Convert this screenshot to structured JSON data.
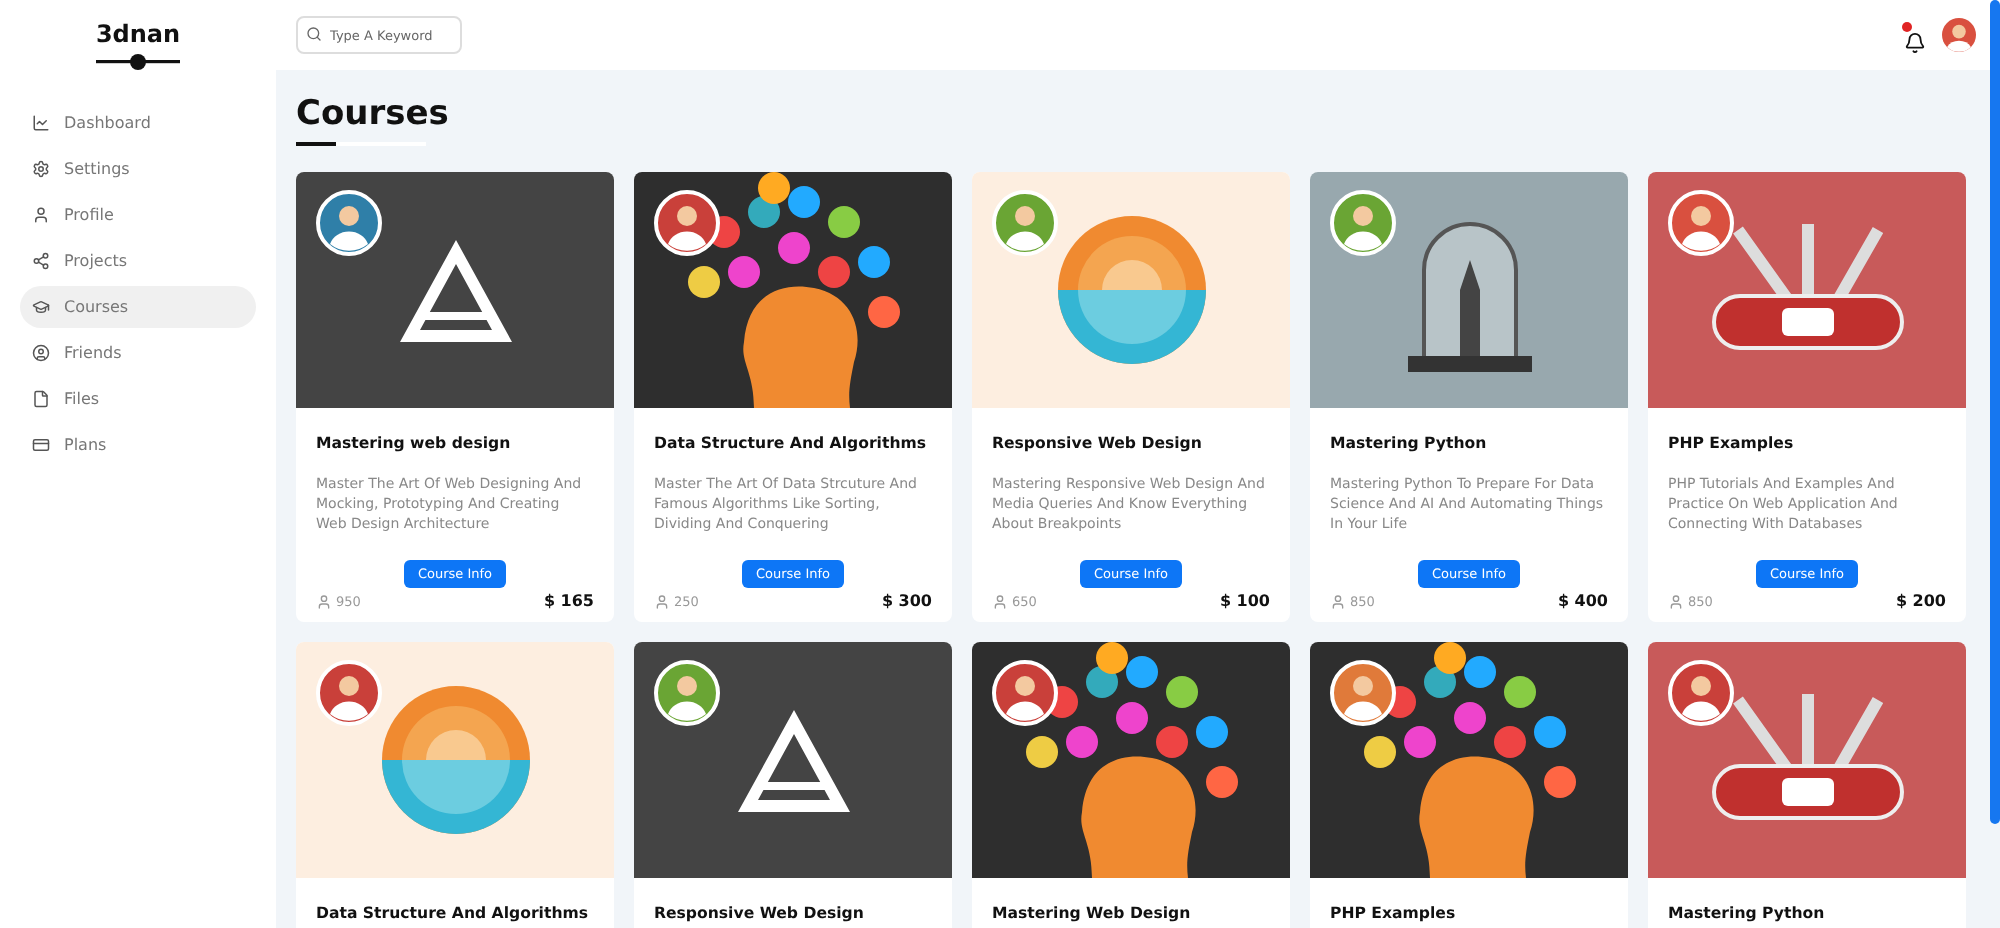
{
  "sidebar": {
    "logo": "3dnan",
    "items": [
      {
        "label": "Dashboard",
        "kind": "chart",
        "selected": false
      },
      {
        "label": "Settings",
        "kind": "gear",
        "selected": false
      },
      {
        "label": "Profile",
        "kind": "user",
        "selected": false
      },
      {
        "label": "Projects",
        "kind": "nodes",
        "selected": false
      },
      {
        "label": "Courses",
        "kind": "cap",
        "selected": true
      },
      {
        "label": "Friends",
        "kind": "contact",
        "selected": false
      },
      {
        "label": "Files",
        "kind": "file",
        "selected": false
      },
      {
        "label": "Plans",
        "kind": "card",
        "selected": false
      }
    ]
  },
  "header": {
    "search": {
      "placeholder": "Type A Keyword"
    },
    "notification": {
      "unread": true
    }
  },
  "page_title": "Courses",
  "courses": [
    {
      "kind": "logo",
      "color": "#2f7fa8",
      "title": "Mastering web design",
      "description": "Master The Art Of Web Designing And Mocking, Prototyping And Creating Web Design Architecture",
      "button": "Course Info",
      "students": "950",
      "price": "$ 165"
    },
    {
      "kind": "brain",
      "color": "#c9403a",
      "title": "Data Structure And Algorithms",
      "description": "Master The Art Of Data Strcuture And Famous Algorithms Like Sorting, Dividing And Conquering",
      "button": "Course Info",
      "students": "250",
      "price": "$ 300"
    },
    {
      "kind": "sun",
      "color": "#6aa534",
      "title": "Responsive Web Design",
      "description": "Mastering Responsive Web Design And Media Queries And Know Everything About Breakpoints",
      "button": "Course Info",
      "students": "650",
      "price": "$ 100"
    },
    {
      "kind": "jar",
      "color": "#6aa534",
      "title": "Mastering Python",
      "description": "Mastering Python To Prepare For Data Science And AI And Automating Things In Your Life",
      "button": "Course Info",
      "students": "850",
      "price": "$ 400"
    },
    {
      "kind": "tools",
      "color": "#d9503f",
      "title": "PHP Examples",
      "description": "PHP Tutorials And Examples And Practice On Web Application And Connecting With Databases",
      "button": "Course Info",
      "students": "850",
      "price": "$ 200"
    },
    {
      "kind": "sun",
      "color": "#c9403a",
      "title": "Data Structure And Algorithms"
    },
    {
      "kind": "logo",
      "color": "#6aa534",
      "title": "Responsive Web Design"
    },
    {
      "kind": "brain",
      "color": "#c9403a",
      "title": "Mastering Web Design"
    },
    {
      "kind": "brain",
      "color": "#e07a3a",
      "title": "PHP Examples"
    },
    {
      "kind": "tools",
      "color": "#c9403a",
      "title": "Mastering Python"
    }
  ]
}
